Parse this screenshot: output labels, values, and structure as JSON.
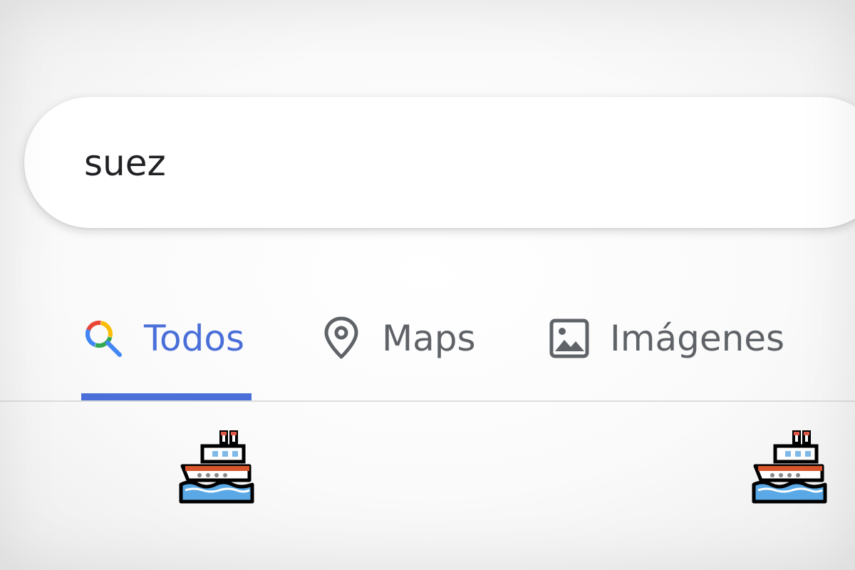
{
  "search": {
    "query": "suez"
  },
  "tabs": [
    {
      "label": "Todos",
      "icon": "search-icon",
      "active": true
    },
    {
      "label": "Maps",
      "icon": "map-pin-icon",
      "active": false
    },
    {
      "label": "Imágenes",
      "icon": "image-icon",
      "active": false
    }
  ],
  "emoji": [
    {
      "name": "ship-emoji"
    },
    {
      "name": "ship-emoji"
    }
  ],
  "colors": {
    "accent": "#4a6fd8",
    "tab_text": "#5f6368",
    "query_text": "#202124"
  }
}
